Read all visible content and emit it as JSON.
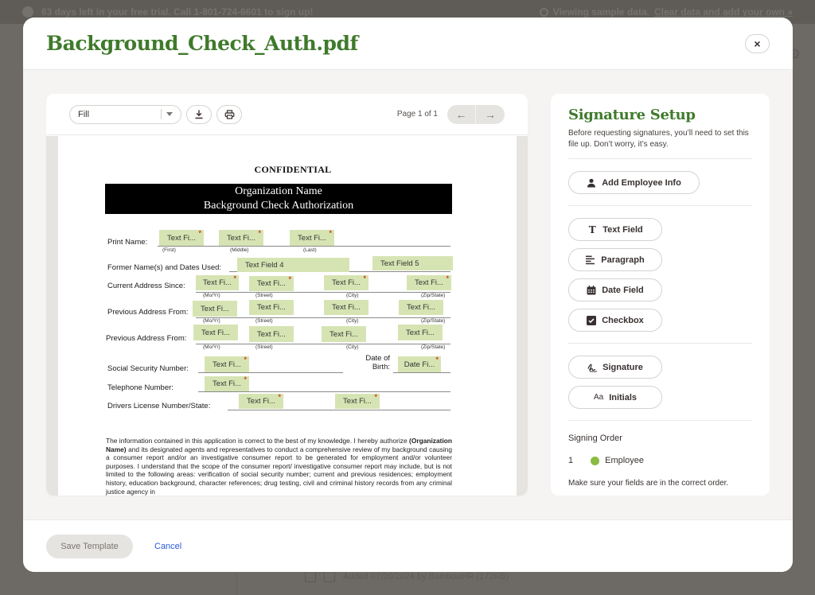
{
  "background": {
    "banner_left": "63 days left in your free trial. Call 1-801-724-6601 to sign up!",
    "banner_right_text": "Viewing sample data.",
    "banner_right_link": "Clear data and add your own »",
    "footer_row_text": "Added 07/20/2024 by BambooHR (172KB)"
  },
  "modal": {
    "title": "Background_Check_Auth.pdf",
    "close_label": "×"
  },
  "viewer": {
    "mode_select_value": "Fill",
    "page_info": "Page 1 of 1",
    "prev_label": "←",
    "next_label": "→",
    "icons": {
      "download": "download-icon",
      "print": "print-icon"
    }
  },
  "document": {
    "confidential": "CONFIDENTIAL",
    "header_line1": "Organization Name",
    "header_line2": "Background Check Authorization",
    "rows": {
      "print_name": "Print Name:",
      "former_names": "Former Name(s) and Dates Used:",
      "current_address": "Current Address Since:",
      "previous_address_1": "Previous Address From:",
      "previous_address_2": "Previous Address From:",
      "ssn": "Social Security Number:",
      "dob_line1": "Date of",
      "dob_line2": "Birth:",
      "telephone": "Telephone Number:",
      "drivers_license": "Drivers License Number/State:"
    },
    "sublabels": {
      "first": "(First)",
      "middle": "(Middle)",
      "last": "(Last)",
      "mo_yr": "(Mo/Yr)",
      "street": "(Street)",
      "city": "(City)",
      "zip_state": "(Zip/State)"
    },
    "fields": {
      "text_short": "Text Fi...",
      "date_short": "Date Fi...",
      "text_field_4": "Text Field 4",
      "text_field_5": "Text Field 5",
      "required_mark": "*"
    },
    "paragraph_bold": "(Organization Name)",
    "paragraph_first": "The information contained in this application is correct to the best of my knowledge.  I hereby authorize",
    "paragraph_rest": "and its designated agents and representatives to conduct a comprehensive review of my background causing a consumer report and/or an investigative consumer report to be generated for employment and/or volunteer purposes.  I understand that the scope of the consumer report/ investigative consumer report may include, but is not limited to the following areas: verification of social security number; current and previous residences; employment history, education background, character references; drug testing, civil and criminal history records from any criminal justice agency in"
  },
  "panel": {
    "title": "Signature Setup",
    "description": "Before requesting signatures, you’ll need to set this file up. Don’t worry, it’s easy.",
    "add_employee_info": "Add Employee Info",
    "field_buttons": [
      {
        "label": "Text Field",
        "icon": "text-field-icon"
      },
      {
        "label": "Paragraph",
        "icon": "paragraph-icon"
      },
      {
        "label": "Date Field",
        "icon": "calendar-icon"
      },
      {
        "label": "Checkbox",
        "icon": "checkbox-icon"
      }
    ],
    "signature_buttons": [
      {
        "label": "Signature",
        "icon": "signature-icon"
      },
      {
        "label": "Initials",
        "icon": "initials-icon",
        "glyph": "Aa"
      }
    ],
    "signing_order_label": "Signing Order",
    "signing_order": [
      {
        "number": "1",
        "name": "Employee",
        "color": "#8bbb42"
      }
    ],
    "note": "Make sure your fields are in the correct order."
  },
  "footer": {
    "save_label": "Save Template",
    "cancel_label": "Cancel"
  },
  "colors": {
    "brand_green": "#3f7a2b",
    "field_fill": "#d6e4b3",
    "required": "#d0451b",
    "link_blue": "#2a5bd7"
  }
}
